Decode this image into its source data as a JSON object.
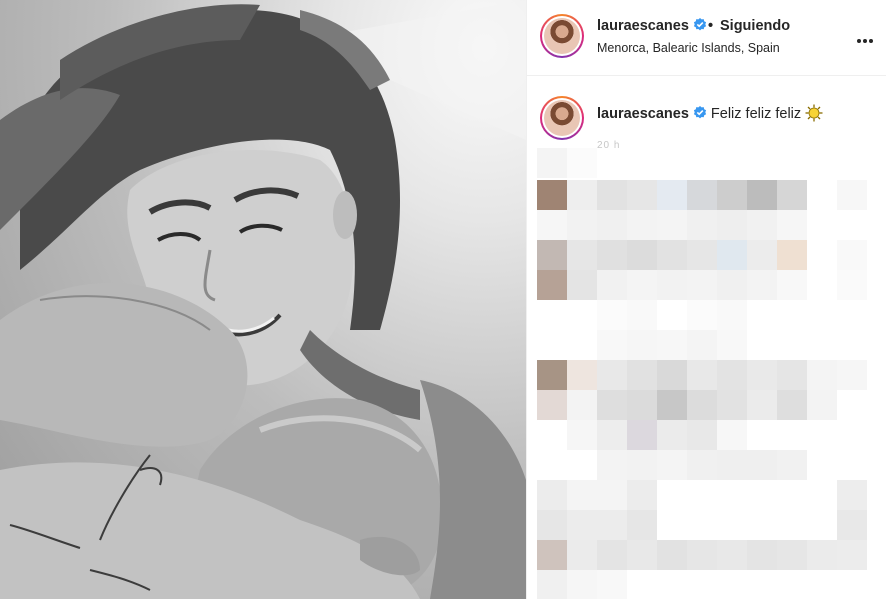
{
  "post": {
    "header": {
      "username": "lauraescanes",
      "separator": "•",
      "follow_status": "Siguiendo",
      "location": "Menorca, Balearic Islands, Spain",
      "more_icon": "three-dots-icon",
      "verified_icon": "verified-badge-icon"
    },
    "caption": {
      "username": "lauraescanes",
      "text": "Feliz feliz feliz",
      "emoji_icon": "sun-emoji-icon",
      "timestamp": "20 h"
    },
    "photo": {
      "description_icon": "post-photo"
    },
    "colors": {
      "verified": "#3897f0",
      "border": "#efefef",
      "text": "#262626",
      "muted": "#8e8e8e"
    }
  }
}
